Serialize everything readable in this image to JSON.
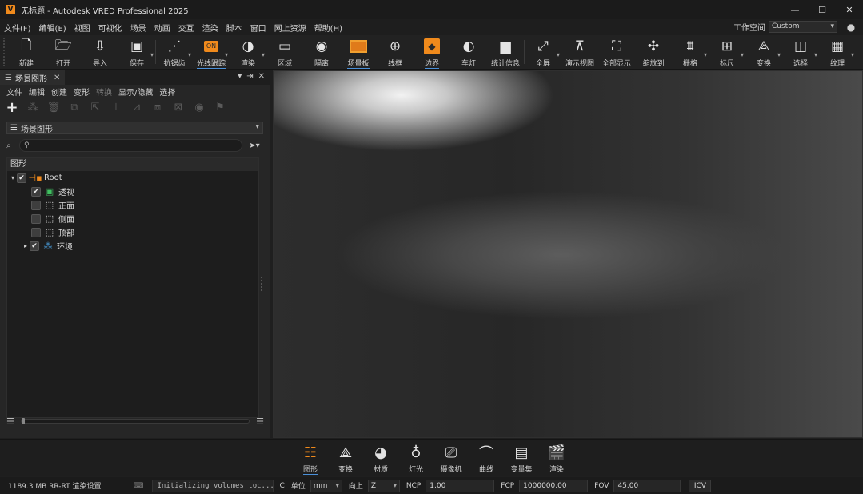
{
  "titlebar": {
    "logo": "V",
    "title": "无标题 - Autodesk VRED Professional 2025",
    "minimize": "—",
    "maximize": "☐",
    "close": "✕"
  },
  "menubar": {
    "items": [
      "文件(F)",
      "编辑(E)",
      "视图",
      "可视化",
      "场景",
      "动画",
      "交互",
      "渲染",
      "脚本",
      "窗口",
      "网上资源",
      "帮助(H)"
    ],
    "workspace_label": "工作空间",
    "workspace_value": "Custom"
  },
  "toolbar": {
    "items": [
      {
        "label": "新建",
        "icon": "new-file-icon"
      },
      {
        "label": "打开",
        "icon": "open-folder-icon"
      },
      {
        "label": "导入",
        "icon": "import-icon"
      },
      {
        "label": "保存",
        "icon": "save-icon"
      },
      {
        "label": "抗锯齿",
        "icon": "antialias-icon"
      },
      {
        "label": "光线跟踪",
        "icon": "raytracing-icon"
      },
      {
        "label": "渲染",
        "icon": "render-mode-icon"
      },
      {
        "label": "区域",
        "icon": "region-icon"
      },
      {
        "label": "隔离",
        "icon": "isolate-icon"
      },
      {
        "label": "场景板",
        "icon": "sceneplate-icon"
      },
      {
        "label": "线框",
        "icon": "wireframe-icon"
      },
      {
        "label": "边界",
        "icon": "bounding-box-icon"
      },
      {
        "label": "车灯",
        "icon": "headlight-icon"
      },
      {
        "label": "统计信息",
        "icon": "statistics-icon"
      },
      {
        "label": "全屏",
        "icon": "fullscreen-icon"
      },
      {
        "label": "演示视图",
        "icon": "presentation-icon"
      },
      {
        "label": "全部显示",
        "icon": "show-all-icon"
      },
      {
        "label": "缩放到",
        "icon": "zoom-to-icon"
      },
      {
        "label": "栅格",
        "icon": "grid-icon"
      },
      {
        "label": "标尺",
        "icon": "ruler-icon"
      },
      {
        "label": "变换",
        "icon": "transform-icon"
      },
      {
        "label": "选择",
        "icon": "select-icon"
      },
      {
        "label": "纹理",
        "icon": "texture-icon"
      }
    ]
  },
  "sidepanel": {
    "tab_title": "场景图形",
    "menu": [
      "文件",
      "编辑",
      "创建",
      "变形",
      "转换",
      "显示/隐藏",
      "选择"
    ],
    "view_select": "场景图形",
    "search_placeholder": "",
    "tree_header": "图形",
    "nodes": [
      {
        "label": "Root",
        "checked": "✔",
        "arrow": "▾",
        "icon": "root-node-icon"
      },
      {
        "label": "透视",
        "checked": "✔",
        "arrow": "",
        "icon": "perspective-camera-icon"
      },
      {
        "label": "正面",
        "checked": "",
        "arrow": "",
        "icon": "front-camera-icon"
      },
      {
        "label": "侧面",
        "checked": "",
        "arrow": "",
        "icon": "side-camera-icon"
      },
      {
        "label": "顶部",
        "checked": "",
        "arrow": "",
        "icon": "top-camera-icon"
      },
      {
        "label": "环境",
        "checked": "✔",
        "arrow": "▸",
        "icon": "environment-icon"
      }
    ]
  },
  "dock": {
    "items": [
      {
        "label": "图形",
        "icon": "scenegraph-icon"
      },
      {
        "label": "变换",
        "icon": "transform-icon"
      },
      {
        "label": "材质",
        "icon": "material-icon"
      },
      {
        "label": "灯光",
        "icon": "light-icon"
      },
      {
        "label": "摄像机",
        "icon": "camera-icon"
      },
      {
        "label": "曲线",
        "icon": "curve-icon"
      },
      {
        "label": "变量集",
        "icon": "variant-sets-icon"
      },
      {
        "label": "渲染",
        "icon": "render-icon"
      }
    ]
  },
  "status": {
    "memory": "1189.3 MB  RR-RT  渲染设置",
    "message": "Initializing volumes toc...",
    "cc": "C",
    "unit_label": "单位",
    "unit_value": "mm",
    "up_label": "向上",
    "up_value": "Z",
    "ncp_label": "NCP",
    "ncp_value": "1.00",
    "fcp_label": "FCP",
    "fcp_value": "1000000.00",
    "fov_label": "FOV",
    "fov_value": "45.00",
    "icv_label": "ICV"
  },
  "colors": {
    "accent": "#f08a1c",
    "active_underline": "#4a90d9",
    "panel_bg": "#262626",
    "app_bg": "#1f1f1f"
  }
}
